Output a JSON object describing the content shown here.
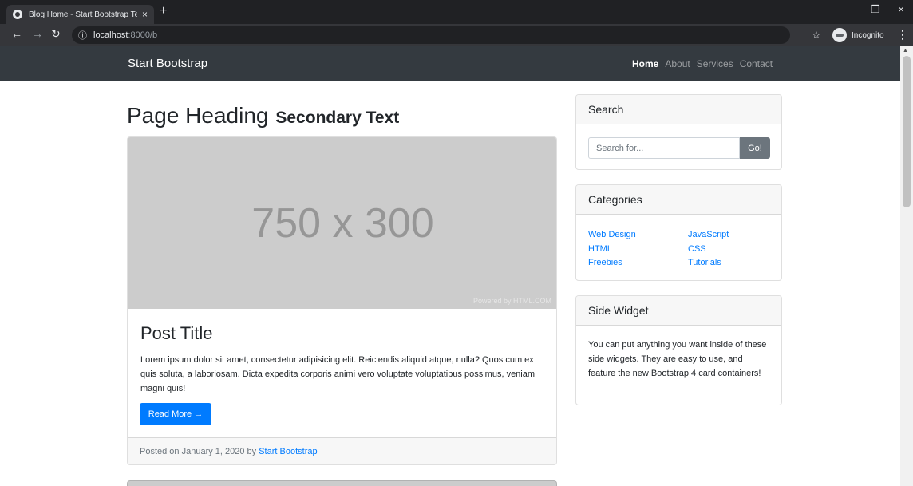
{
  "browser": {
    "tab_title": "Blog Home - Start Bootstrap Tem",
    "tab_close": "×",
    "new_tab": "+",
    "url_host": "localhost",
    "url_rest": ":8000/b",
    "incognito_label": "Incognito",
    "window_min": "–",
    "window_restore": "❐",
    "window_close": "×"
  },
  "navbar": {
    "brand": "Start Bootstrap",
    "links": [
      {
        "label": "Home",
        "active": true
      },
      {
        "label": "About",
        "active": false
      },
      {
        "label": "Services",
        "active": false
      },
      {
        "label": "Contact",
        "active": false
      }
    ]
  },
  "heading": {
    "main": "Page Heading",
    "secondary": "Secondary Text"
  },
  "post": {
    "image_dims": "750 x 300",
    "image_credit": "Powered by HTML.COM",
    "title": "Post Title",
    "excerpt": "Lorem ipsum dolor sit amet, consectetur adipisicing elit. Reiciendis aliquid atque, nulla? Quos cum ex quis soluta, a laboriosam. Dicta expedita corporis animi vero voluptate voluptatibus possimus, veniam magni quis!",
    "read_more": "Read More →",
    "footer_prefix": "Posted on January 1, 2020 by ",
    "author": "Start Bootstrap"
  },
  "sidebar": {
    "search": {
      "title": "Search",
      "placeholder": "Search for...",
      "button": "Go!"
    },
    "categories": {
      "title": "Categories",
      "items": [
        "Web Design",
        "JavaScript",
        "HTML",
        "CSS",
        "Freebies",
        "Tutorials"
      ]
    },
    "widget": {
      "title": "Side Widget",
      "text": "You can put anything you want inside of these side widgets. They are easy to use, and feature the new Bootstrap 4 card containers!"
    }
  },
  "colors": {
    "navbar_bg": "#343a40",
    "primary": "#007bff",
    "secondary": "#6c757d",
    "placeholder_bg": "#cccccc"
  }
}
